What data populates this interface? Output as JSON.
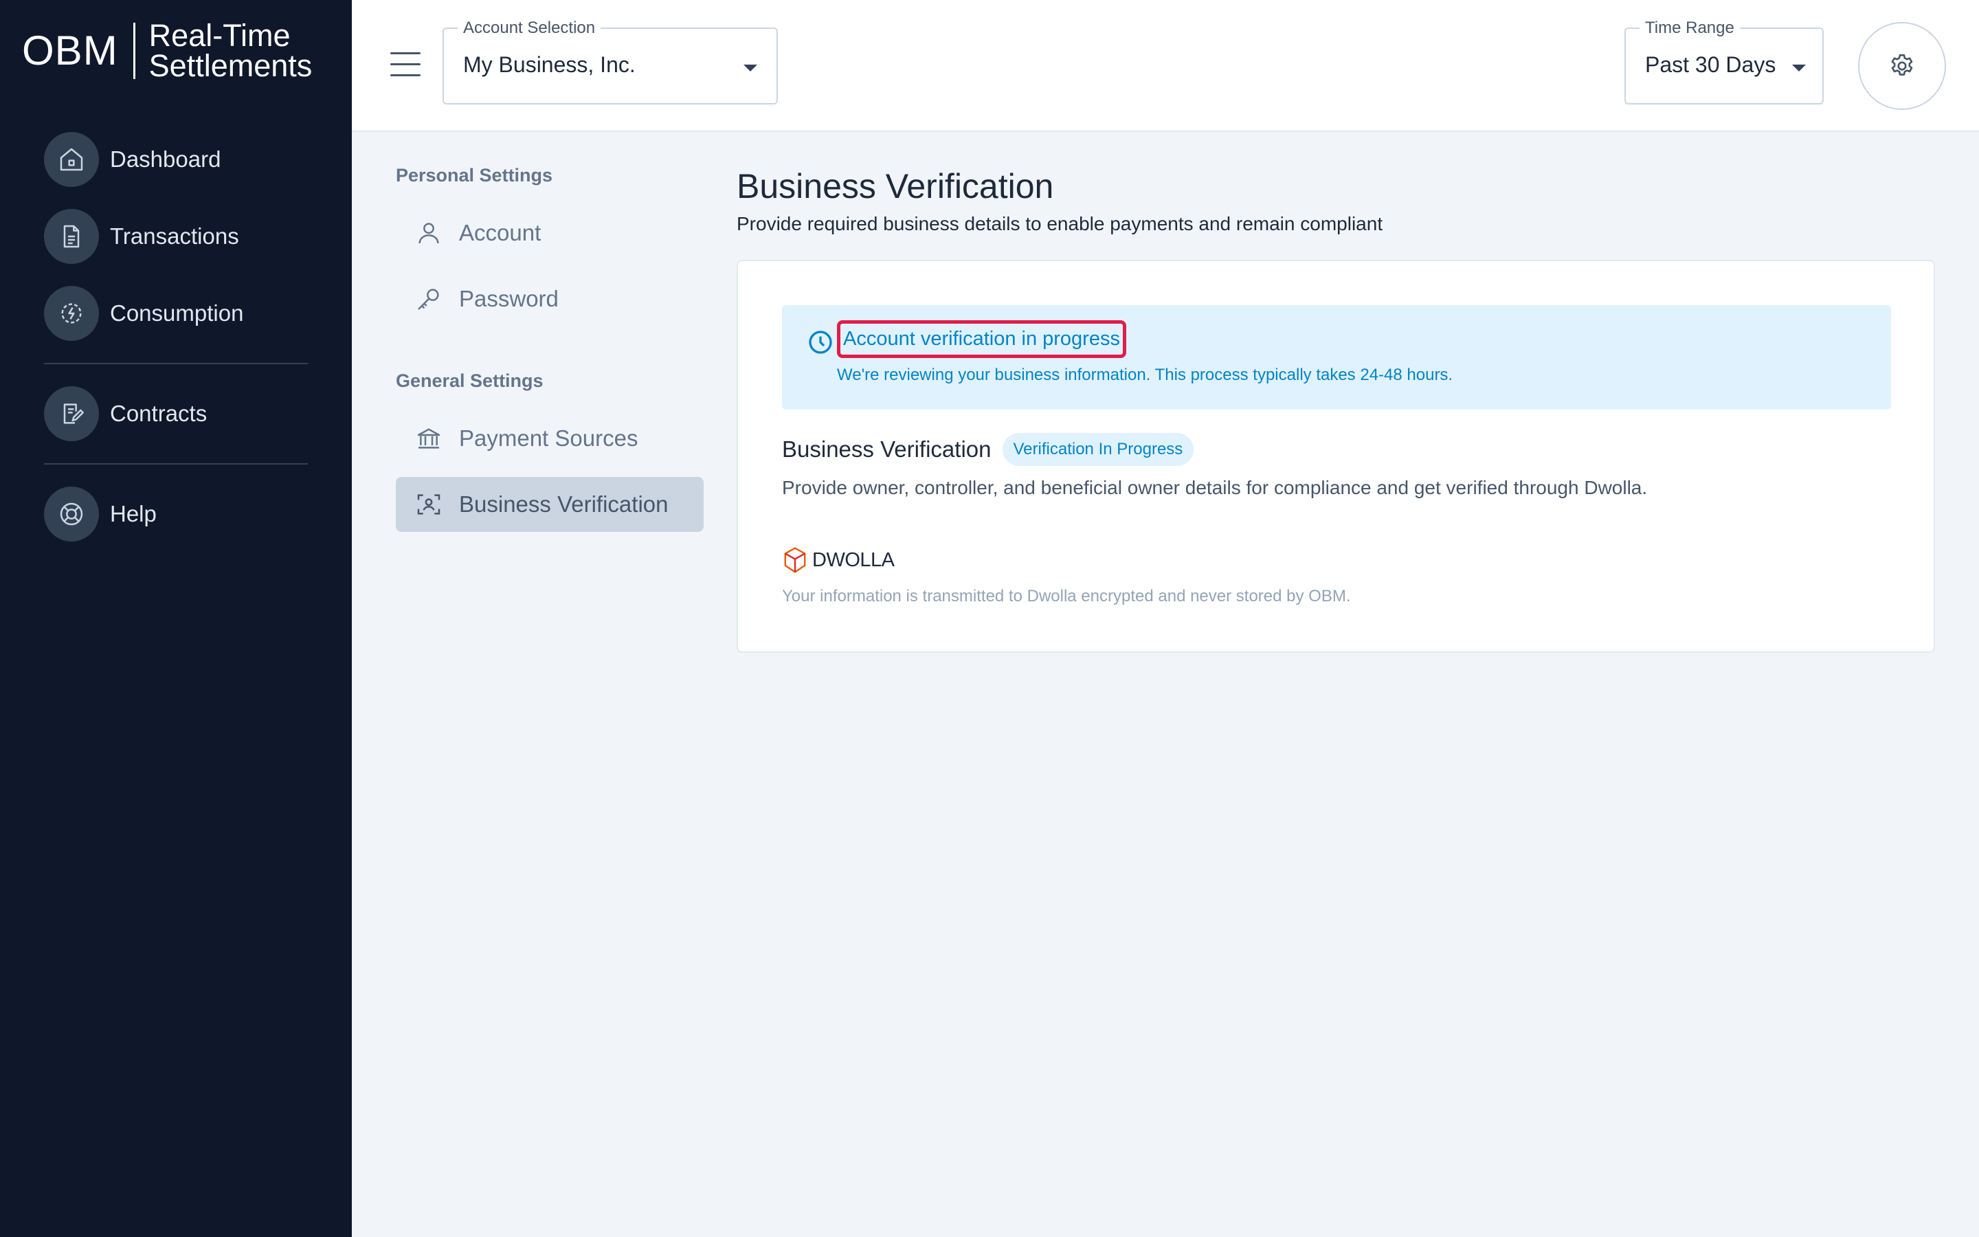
{
  "brand": {
    "logo": "OBM",
    "product_line1": "Real-Time",
    "product_line2": "Settlements"
  },
  "sidebar": {
    "items": [
      {
        "label": "Dashboard",
        "icon": "home-icon"
      },
      {
        "label": "Transactions",
        "icon": "document-icon"
      },
      {
        "label": "Consumption",
        "icon": "energy-icon"
      },
      {
        "label": "Contracts",
        "icon": "contract-icon"
      },
      {
        "label": "Help",
        "icon": "lifebuoy-icon"
      }
    ]
  },
  "topbar": {
    "account_selection": {
      "label": "Account Selection",
      "value": "My Business, Inc."
    },
    "time_range": {
      "label": "Time Range",
      "value": "Past 30 Days"
    }
  },
  "settings_nav": {
    "personal_heading": "Personal Settings",
    "general_heading": "General Settings",
    "items": [
      {
        "label": "Account",
        "icon": "user-icon"
      },
      {
        "label": "Password",
        "icon": "key-icon"
      },
      {
        "label": "Payment Sources",
        "icon": "bank-icon"
      },
      {
        "label": "Business Verification",
        "icon": "face-scan-icon",
        "active": true
      }
    ]
  },
  "main": {
    "title": "Business Verification",
    "description": "Provide required business details to enable payments and remain compliant",
    "alert": {
      "title": "Account verification in progress",
      "body": "We're reviewing your business information. This process typically takes 24-48 hours."
    },
    "section_title": "Business Verification",
    "badge": "Verification In Progress",
    "section_desc": "Provide owner, controller, and beneficial owner details for compliance and get verified through Dwolla.",
    "provider": "DWOLLA",
    "provider_note": "Your information is transmitted to Dwolla encrypted and never stored by OBM."
  },
  "colors": {
    "sidebar_bg": "#0f172a",
    "accent": "#0284c7",
    "alert_bg": "#e0f2fe",
    "highlight": "#e11d48"
  }
}
